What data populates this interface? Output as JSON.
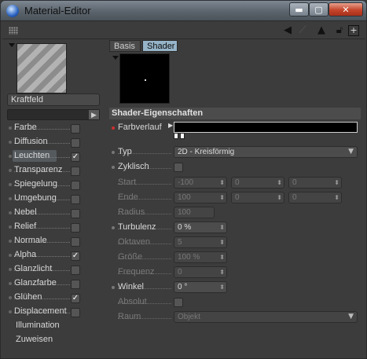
{
  "window": {
    "title": "Material-Editor",
    "min_symbol": "▬",
    "max_symbol": "▢",
    "close_symbol": "✕"
  },
  "toolbar": {
    "icons": [
      "back-arrow-icon",
      "forward-arrow-icon",
      "up-arrow-icon",
      "lock-icon",
      "new-window-icon"
    ]
  },
  "material": {
    "name": "Kraftfeld"
  },
  "channels": [
    {
      "label": "Farbe",
      "checked": false
    },
    {
      "label": "Diffusion",
      "checked": false
    },
    {
      "label": "Leuchten",
      "checked": true,
      "active": true
    },
    {
      "label": "Transparenz",
      "checked": false
    },
    {
      "label": "Spiegelung",
      "checked": false
    },
    {
      "label": "Umgebung",
      "checked": false
    },
    {
      "label": "Nebel",
      "checked": false
    },
    {
      "label": "Relief",
      "checked": false
    },
    {
      "label": "Normale",
      "checked": false
    },
    {
      "label": "Alpha",
      "checked": true
    },
    {
      "label": "Glanzlicht",
      "checked": false
    },
    {
      "label": "Glanzfarbe",
      "checked": false
    },
    {
      "label": "Glühen",
      "checked": true
    },
    {
      "label": "Displacement",
      "checked": false
    }
  ],
  "extra_items": [
    "Illumination",
    "Zuweisen"
  ],
  "tabs": [
    "Basis",
    "Shader"
  ],
  "active_tab": "Shader",
  "section_title": "Shader-Eigenschaften",
  "fields": {
    "farbverlauf": "Farbverlauf",
    "typ": {
      "label": "Typ",
      "value": "2D - Kreisförmig"
    },
    "zyklisch": {
      "label": "Zyklisch",
      "checked": false
    },
    "start": {
      "label": "Start",
      "values": [
        "-100",
        "0",
        "0"
      ]
    },
    "ende": {
      "label": "Ende",
      "values": [
        "100",
        "0",
        "0"
      ]
    },
    "radius": {
      "label": "Radius",
      "value": "100"
    },
    "turbulenz": {
      "label": "Turbulenz",
      "value": "0 %"
    },
    "oktaven": {
      "label": "Oktaven",
      "value": "5"
    },
    "groesse": {
      "label": "Größe",
      "value": "100 %"
    },
    "frequenz": {
      "label": "Frequenz",
      "value": "0"
    },
    "winkel": {
      "label": "Winkel",
      "value": "0 °"
    },
    "absolut": {
      "label": "Absolut",
      "checked": false
    },
    "raum": {
      "label": "Raum",
      "value": "Objekt"
    }
  },
  "colors": {
    "accent_tab": "#96b4c8",
    "highlight_dot": "#d03030"
  }
}
